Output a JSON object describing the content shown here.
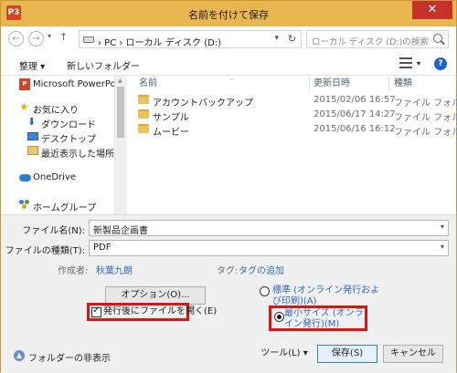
{
  "window": {
    "title": "名前を付けて保存",
    "app_icon": "P3",
    "close_symbol": "✕"
  },
  "nav": {
    "back_symbol": "←",
    "forward_symbol": "→",
    "history_symbol": "▾",
    "up_symbol": "↑",
    "address": "› PC › ローカル ディスク (D:)",
    "address_chevron": "▾",
    "refresh_symbol": "↻",
    "search_placeholder": "ローカル ディスク (D:)の検索"
  },
  "toolbar": {
    "organize": "整理 ▾",
    "new_folder": "新しいフォルダー",
    "view_dropdown": "▾",
    "help": "?"
  },
  "sidebar": {
    "items": [
      {
        "label": "Microsoft PowerPoint",
        "icon": "powerpoint-icon"
      },
      {
        "label": "お気に入り",
        "icon": "star-icon"
      },
      {
        "label": "ダウンロード",
        "icon": "download-icon"
      },
      {
        "label": "デスクトップ",
        "icon": "desktop-icon"
      },
      {
        "label": "最近表示した場所",
        "icon": "recent-places-icon"
      },
      {
        "label": "OneDrive",
        "icon": "onedrive-icon"
      },
      {
        "label": "ホームグループ",
        "icon": "homegroup-icon"
      }
    ],
    "scroll_up": "▲"
  },
  "filelist": {
    "columns": [
      "名前",
      "更新日時",
      "種類"
    ],
    "sort_arrow": "˄",
    "rows": [
      {
        "name": "アカウントバックアップ",
        "date": "2015/02/06 16:57",
        "kind": "ファイル フォルダー"
      },
      {
        "name": "サンプル",
        "date": "2015/06/17 14:27",
        "kind": "ファイル フォルダー"
      },
      {
        "name": "ムービー",
        "date": "2015/06/16 16:12",
        "kind": "ファイル フォルダー"
      }
    ]
  },
  "form": {
    "filename_label": "ファイル名(N):",
    "filename_value": "新製品企画書",
    "filetype_label": "ファイルの種類(T):",
    "filetype_value": "PDF",
    "dropdown_symbol": "▾",
    "author_label": "作成者:",
    "author_value": "秋葉九朗",
    "tags_label": "タグ:",
    "tags_value": "タグの追加",
    "options_button": "オプション(O)...",
    "open_after_publish": "発行後にファイルを開く(E)",
    "radio_standard": "標準 (オンライン発行および印刷)(A)",
    "radio_minimum": "最小サイズ (オンライン発行)(M)",
    "hide_folders": "フォルダーの非表示",
    "hide_icon_symbol": "▲",
    "tools_button": "ツール(L)  ▾",
    "save_button": "保存(S)",
    "cancel_button": "キャンセル"
  }
}
